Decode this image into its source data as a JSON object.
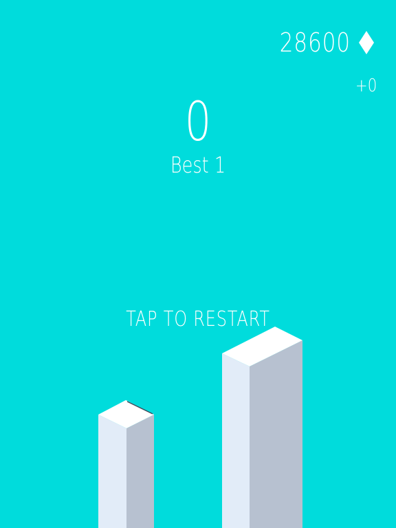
{
  "hud": {
    "gems_count": "28600",
    "gem_icon": "diamond-icon",
    "gems_gained": "+0"
  },
  "score": {
    "current": "0",
    "best_label": "Best 1"
  },
  "prompt": {
    "restart_label": "TAP TO RESTART"
  },
  "colors": {
    "background": "#00DCDC",
    "pillar_front": "#E2ECF8",
    "pillar_side": "#B7C1D0",
    "pillar_top": "#FFFFFF"
  }
}
